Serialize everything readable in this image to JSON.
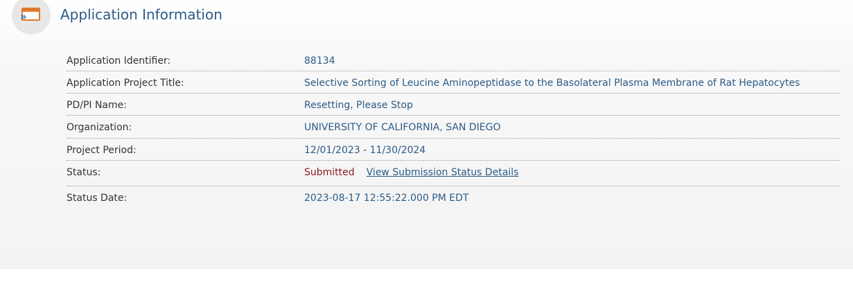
{
  "section": {
    "title": "Application Information",
    "icon": "application-window-icon",
    "accent_color": "#de7a2d",
    "title_color": "#2b5b87"
  },
  "fields": {
    "app_id": {
      "label": "Application Identifier:",
      "value": "88134"
    },
    "project_title": {
      "label": "Application Project Title:",
      "value": "Selective Sorting of Leucine Aminopeptidase to the Basolateral Plasma Membrane of Rat Hepatocytes"
    },
    "pdpi": {
      "label": "PD/PI Name:",
      "value": "Resetting, Please Stop"
    },
    "organization": {
      "label": "Organization:",
      "value": "UNIVERSITY OF CALIFORNIA, SAN DIEGO"
    },
    "period": {
      "label": "Project Period:",
      "value": "12/01/2023 - 11/30/2024"
    },
    "status": {
      "label": "Status:",
      "value": "Submitted",
      "link": "View Submission Status Details",
      "value_color": "#8a1a1a"
    },
    "status_date": {
      "label": "Status Date:",
      "value": "2023-08-17 12:55:22.000 PM EDT"
    }
  }
}
